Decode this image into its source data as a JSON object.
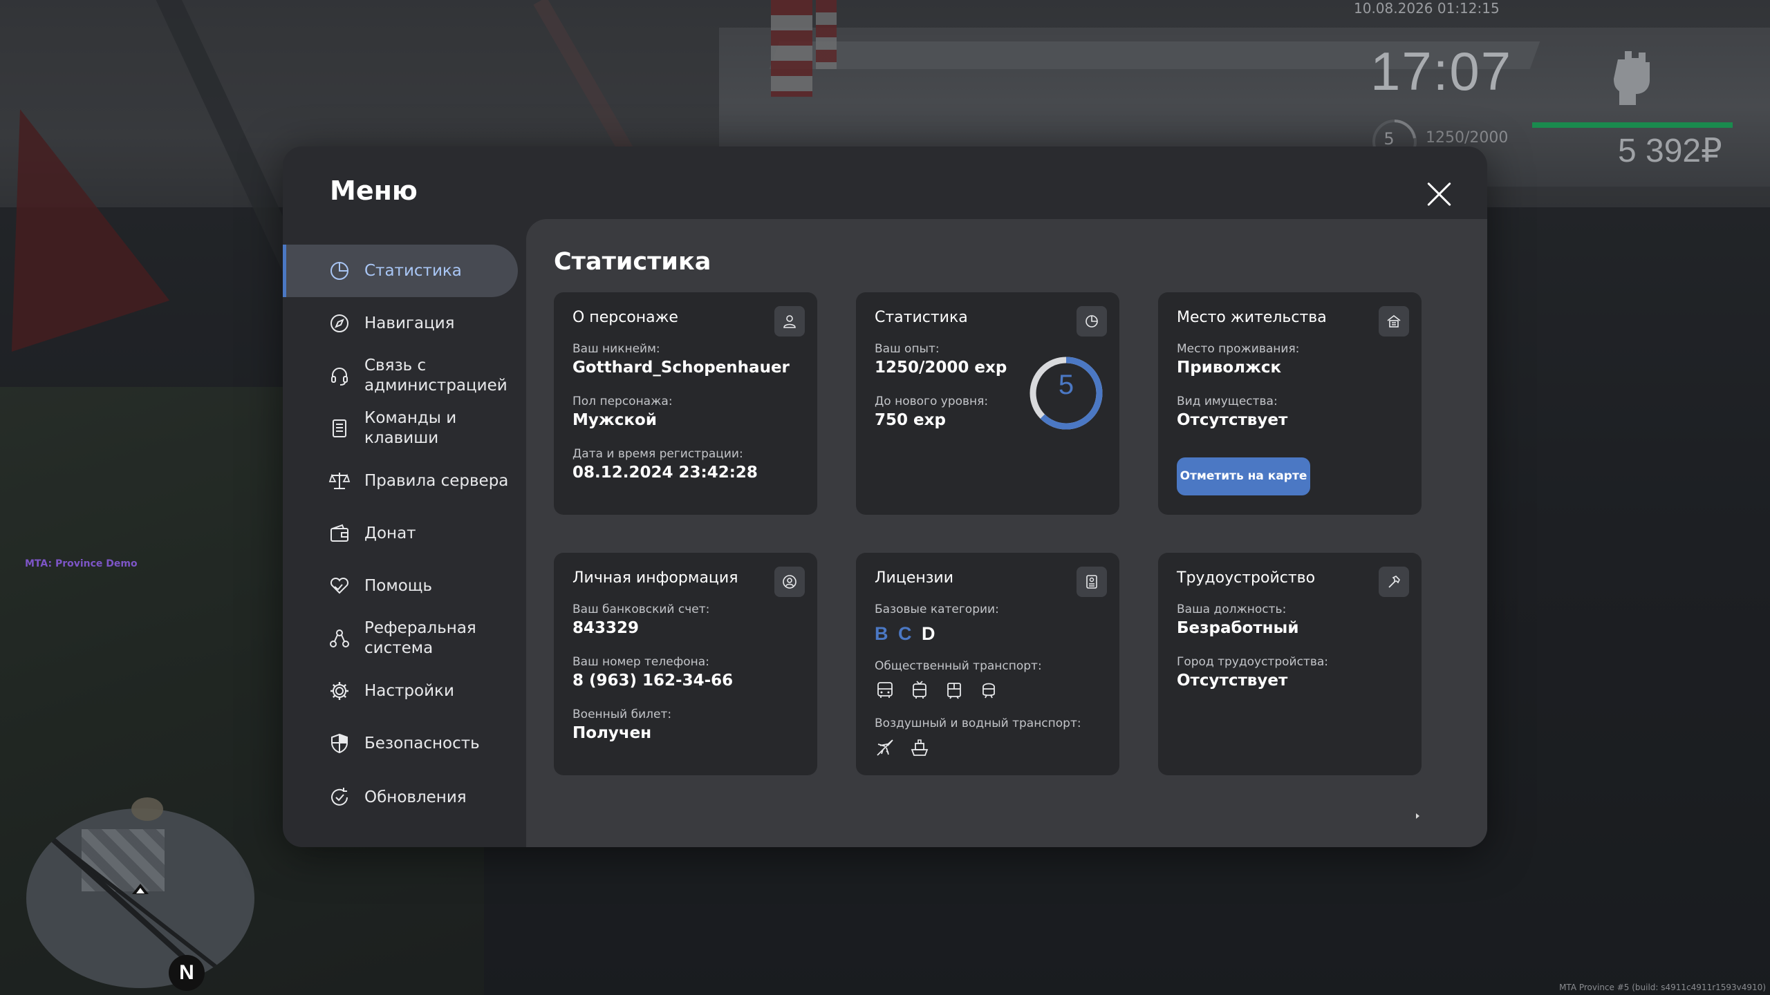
{
  "hud": {
    "datetime": "10.08.2026 01:12:15",
    "time": "17:07",
    "level": "5",
    "exp": "1250/2000",
    "money": "5 392₽",
    "server_name": "MTA: Province Demo",
    "build": "MTA Province #5 (build: s4911c4911r1593v4910)",
    "health_color": "#1a8a4e"
  },
  "menu": {
    "title": "Меню",
    "accent_color": "#4b78c4",
    "sidebar": [
      {
        "label": "Статистика",
        "icon": "pie-chart-icon",
        "active": true
      },
      {
        "label": "Навигация",
        "icon": "compass-icon",
        "active": false
      },
      {
        "label": "Связь с\nадминистрацией",
        "icon": "headset-icon",
        "active": false
      },
      {
        "label": "Команды и\nклавиши",
        "icon": "document-list-icon",
        "active": false
      },
      {
        "label": "Правила сервера",
        "icon": "scales-icon",
        "active": false
      },
      {
        "label": "Донат",
        "icon": "wallet-icon",
        "active": false
      },
      {
        "label": "Помощь",
        "icon": "heart-hand-icon",
        "active": false
      },
      {
        "label": "Реферальная\nсистема",
        "icon": "referral-network-icon",
        "active": false
      },
      {
        "label": "Настройки",
        "icon": "gear-icon",
        "active": false
      },
      {
        "label": "Безопасность",
        "icon": "shield-icon",
        "active": false
      },
      {
        "label": "Обновления",
        "icon": "refresh-check-icon",
        "active": false
      }
    ]
  },
  "content": {
    "title": "Статистика",
    "character": {
      "title": "О персонаже",
      "nickname_label": "Ваш никнейм:",
      "nickname": "Gotthard_Schopenhauer",
      "gender_label": "Пол персонажа:",
      "gender": "Мужской",
      "reg_label": "Дата и время регистрации:",
      "reg_date": "08.12.2024 23:42:28"
    },
    "stats": {
      "title": "Статистика",
      "exp_label": "Ваш опыт:",
      "exp": "1250/2000 exp",
      "next_label": "До нового уровня:",
      "next": "750 exp",
      "level": "5",
      "progress": 0.625
    },
    "residence": {
      "title": "Место жительства",
      "place_label": "Место проживания:",
      "place": "Приволжск",
      "property_label": "Вид имущества:",
      "property": "Отсутствует",
      "button": "Отметить на карте"
    },
    "personal": {
      "title": "Личная информация",
      "bank_label": "Ваш банковский счет:",
      "bank": "843329",
      "phone_label": "Ваш номер телефона:",
      "phone": "8 (963) 162-34-66",
      "military_label": "Военный билет:",
      "military": "Получен"
    },
    "licenses": {
      "title": "Лицензии",
      "base_label": "Базовые категории:",
      "categories": [
        {
          "name": "B",
          "color": "#4b78c4"
        },
        {
          "name": "C",
          "color": "#4b78c4"
        },
        {
          "name": "D",
          "color": "#ffffff"
        }
      ],
      "public_label": "Общественный транспорт:",
      "public_icons": [
        "bus-icon",
        "trolleybus-icon",
        "tram-icon",
        "subway-icon"
      ],
      "air_label": "Воздушный и водный транспорт:",
      "air_icons": [
        "airplane-icon",
        "ship-icon"
      ]
    },
    "employment": {
      "title": "Трудоустройство",
      "position_label": "Ваша должность:",
      "position": "Безработный",
      "city_label": "Город трудоустройства:",
      "city": "Отсутствует"
    }
  }
}
